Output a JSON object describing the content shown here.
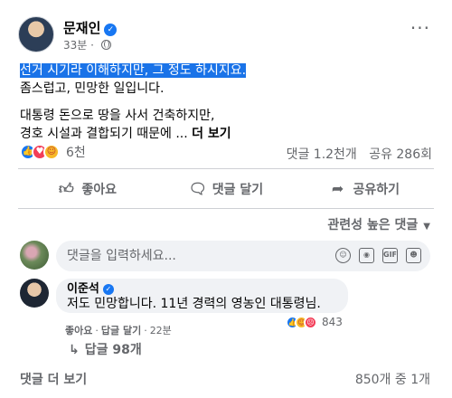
{
  "post": {
    "author": "문재인",
    "time": "33분",
    "lines": {
      "highlight": "선거 시기라 이해하지만, 그 정도 하시지요.",
      "l2": "좀스럽고, 민망한 일입니다.",
      "l3": "대통령 돈으로 땅을 사서 건축하지만,",
      "l4": "경호 시설과 결합되기 때문에 ...",
      "see_more": "더 보기"
    },
    "reactions": {
      "icons": [
        "like-icon",
        "love-icon",
        "care-icon"
      ],
      "count": "6천"
    },
    "comments_count": "댓글 1.2천개",
    "shares_count": "공유 286회"
  },
  "actions": {
    "like": "좋아요",
    "comment": "댓글 달기",
    "share": "공유하기"
  },
  "sort": {
    "label": "관련성 높은 댓글"
  },
  "comment_input": {
    "placeholder": "댓글을 입력하세요..."
  },
  "comment": {
    "author": "이준석",
    "text": "저도 민망합니다. 11년 경력의 영농인 대통령님.",
    "reaction_count": "843",
    "like": "좋아요",
    "reply": "답글 달기",
    "time": "22분",
    "replies": "답글 98개"
  },
  "footer": {
    "more_comments": "댓글 더 보기",
    "count": "850개 중 1개"
  },
  "colors": {
    "accent": "#1877f2",
    "highlight": "#1a73e8",
    "secondary_text": "#65676b"
  }
}
